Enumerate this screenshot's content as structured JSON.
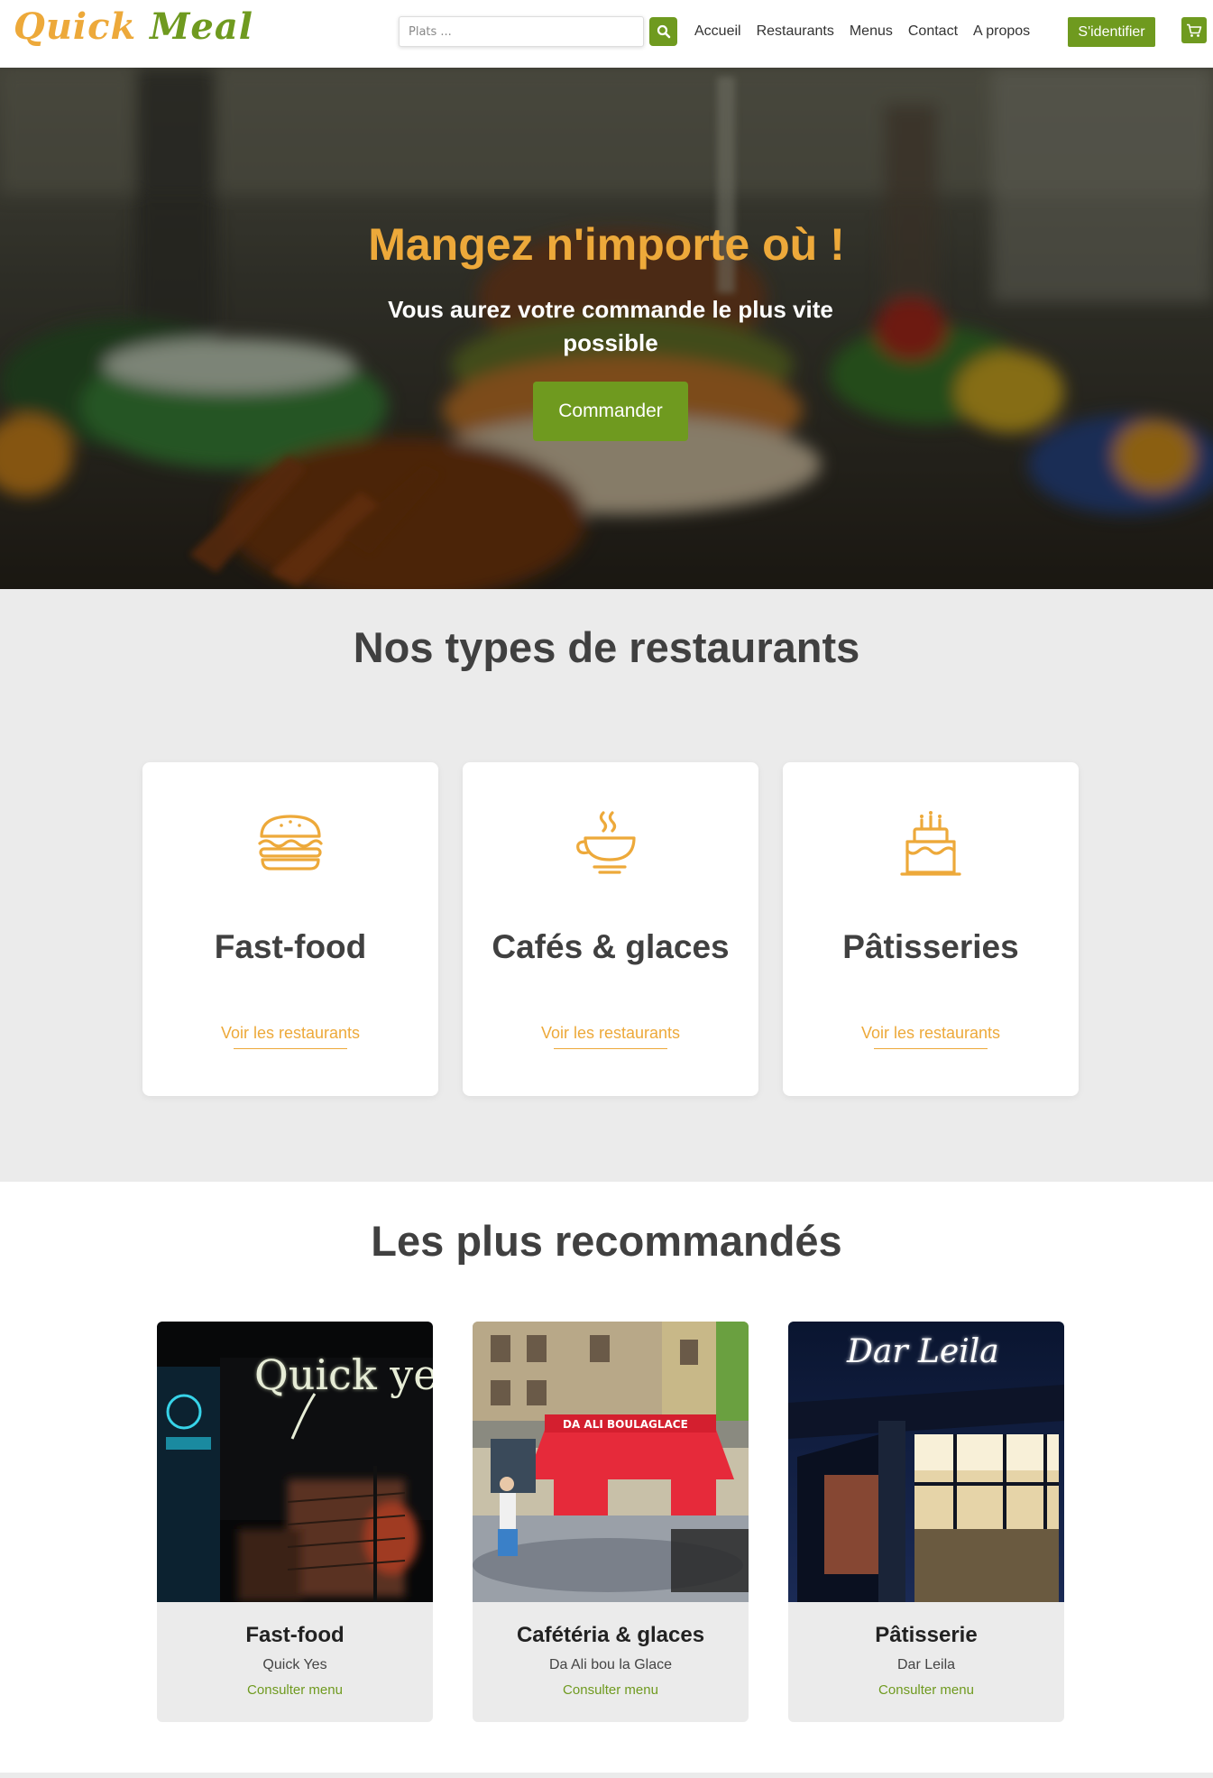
{
  "brand": {
    "part1": "Quick",
    "part2": "Meal"
  },
  "search": {
    "placeholder": "Plats ..."
  },
  "nav": {
    "links": [
      "Accueil",
      "Restaurants",
      "Menus",
      "Contact",
      "A propos"
    ],
    "login_label": "S'identifier"
  },
  "hero": {
    "title": "Mangez n'importe où !",
    "subtitle": "Vous aurez votre commande le plus vite possible",
    "cta_label": "Commander"
  },
  "types": {
    "title": "Nos types de restaurants",
    "cards": [
      {
        "name": "Fast-food",
        "icon": "burger-icon",
        "link": "Voir les restaurants"
      },
      {
        "name": "Cafés & glaces",
        "icon": "coffee-cup-icon",
        "link": "Voir les restaurants"
      },
      {
        "name": "Pâtisseries",
        "icon": "cake-icon",
        "link": "Voir les restaurants"
      }
    ]
  },
  "recommended": {
    "title": "Les plus recommandés",
    "cards": [
      {
        "category": "Fast-food",
        "restaurant": "Quick Yes",
        "link": "Consulter menu",
        "sign": "Quick yes"
      },
      {
        "category": "Cafétéria & glaces",
        "restaurant": "Da Ali bou la Glace",
        "link": "Consulter menu",
        "sign": "DA ALI BOULAGLACE"
      },
      {
        "category": "Pâtisserie",
        "restaurant": "Dar Leila",
        "link": "Consulter menu",
        "sign": "Dar Leila"
      }
    ]
  },
  "colors": {
    "accent": "#eda93a",
    "brand_green": "#6f9a1f",
    "section_bg": "#ebebeb",
    "heading": "#404040"
  }
}
